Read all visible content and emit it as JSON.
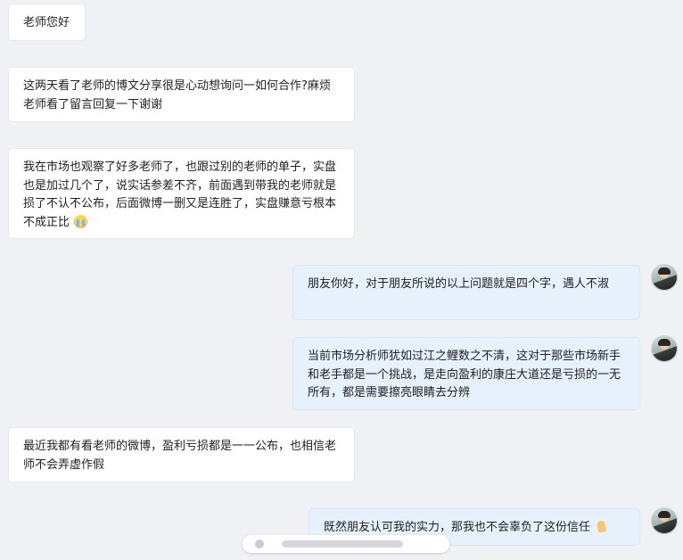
{
  "chat": {
    "messages": [
      {
        "side": "in",
        "text": "老师您好"
      },
      {
        "side": "in",
        "text": "这两天看了老师的博文分享很是心动想询问一如何合作?麻烦老师看了留言回复一下谢谢"
      },
      {
        "side": "in",
        "text": "我在市场也观察了好多老师了，也跟过别的老师的单子，实盘也是加过几个了，说实话参差不齐，前面遇到带我的老师就是损了不认不公布，后面微博一删又是连胜了，实盘赚意亏根本不成正比",
        "emoji": "crying-face-icon"
      },
      {
        "side": "out",
        "text": "朋友你好，对于朋友所说的以上问题就是四个字，遇人不淑"
      },
      {
        "side": "out",
        "text": "当前市场分析师犹如过江之鲤数之不清，这对于那些市场新手和老手都是一个挑战，是走向盈利的康庄大道还是亏损的一无所有，都是需要擦亮眼睛去分辨"
      },
      {
        "side": "in",
        "text": "最近我都有看老师的微博，盈利亏损都是一一公布，也相信老师不会弄虚作假"
      },
      {
        "side": "out",
        "text": "既然朋友认可我的实力，那我也不会辜负了这份信任",
        "emoji": "folded-hands-icon"
      }
    ]
  }
}
